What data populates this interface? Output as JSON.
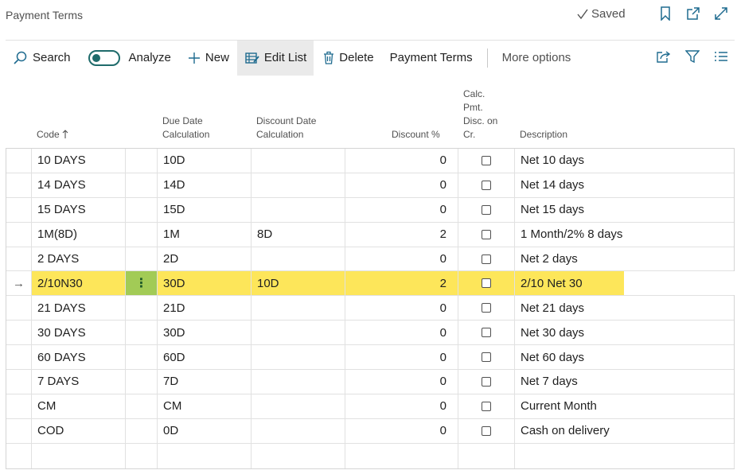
{
  "header": {
    "title": "Payment Terms",
    "saved_label": "Saved"
  },
  "toolbar": {
    "search_label": "Search",
    "analyze_label": "Analyze",
    "new_label": "New",
    "edit_list_label": "Edit List",
    "delete_label": "Delete",
    "payment_terms_label": "Payment Terms",
    "more_options_label": "More options"
  },
  "columns": {
    "code": "Code",
    "due_date": [
      "Due Date",
      "Calculation"
    ],
    "discount_date": [
      "Discount Date",
      "Calculation"
    ],
    "discount_pct": "Discount %",
    "calc_pmt": [
      "Calc.",
      "Pmt.",
      "Disc. on",
      "Cr."
    ],
    "description": "Description"
  },
  "rows": [
    {
      "code": "10 DAYS",
      "due": "10D",
      "disc_date": "",
      "disc_pct": "0",
      "calc": false,
      "desc": "Net 10 days"
    },
    {
      "code": "14 DAYS",
      "due": "14D",
      "disc_date": "",
      "disc_pct": "0",
      "calc": false,
      "desc": "Net 14 days"
    },
    {
      "code": "15 DAYS",
      "due": "15D",
      "disc_date": "",
      "disc_pct": "0",
      "calc": false,
      "desc": "Net 15 days"
    },
    {
      "code": "1M(8D)",
      "due": "1M",
      "disc_date": "8D",
      "disc_pct": "2",
      "calc": false,
      "desc": "1 Month/2% 8 days"
    },
    {
      "code": "2 DAYS",
      "due": "2D",
      "disc_date": "",
      "disc_pct": "0",
      "calc": false,
      "desc": "Net 2 days"
    },
    {
      "code": "2/10N30",
      "due": "30D",
      "disc_date": "10D",
      "disc_pct": "2",
      "calc": false,
      "desc": "2/10 Net 30",
      "selected": true
    },
    {
      "code": "21 DAYS",
      "due": "21D",
      "disc_date": "",
      "disc_pct": "0",
      "calc": false,
      "desc": "Net 21 days"
    },
    {
      "code": "30 DAYS",
      "due": "30D",
      "disc_date": "",
      "disc_pct": "0",
      "calc": false,
      "desc": "Net 30 days"
    },
    {
      "code": "60 DAYS",
      "due": "60D",
      "disc_date": "",
      "disc_pct": "0",
      "calc": false,
      "desc": "Net 60 days"
    },
    {
      "code": "7 DAYS",
      "due": "7D",
      "disc_date": "",
      "disc_pct": "0",
      "calc": false,
      "desc": "Net 7 days"
    },
    {
      "code": "CM",
      "due": "CM",
      "disc_date": "",
      "disc_pct": "0",
      "calc": false,
      "desc": "Current Month"
    },
    {
      "code": "COD",
      "due": "0D",
      "disc_date": "",
      "disc_pct": "0",
      "calc": false,
      "desc": "Cash on delivery"
    }
  ],
  "selected_row_marker": "→",
  "row_menu_glyph": "⋮",
  "colors": {
    "selected_row": "#fde65a",
    "row_menu_cell": "#a2cb56",
    "accent": "#1f6b6b"
  }
}
